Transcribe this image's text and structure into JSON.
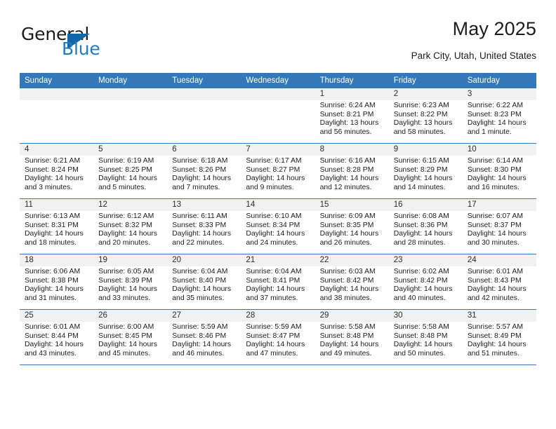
{
  "brand": {
    "name_part1": "General",
    "name_part2": "Blue",
    "logo_icon": "triangle-flag-icon"
  },
  "header": {
    "title": "May 2025",
    "subtitle": "Park City, Utah, United States"
  },
  "colors": {
    "header_blue": "#3378b8",
    "band_gray": "#f1f1f1",
    "logo_blue": "#1d7cc4",
    "logo_triangle": "#1566a8",
    "text": "#1c1c1c"
  },
  "calendar": {
    "weekday_headers": [
      "Sunday",
      "Monday",
      "Tuesday",
      "Wednesday",
      "Thursday",
      "Friday",
      "Saturday"
    ],
    "weeks": [
      [
        {
          "day": "",
          "sunrise": "",
          "sunset": "",
          "daylight1": "",
          "daylight2": "",
          "empty": true
        },
        {
          "day": "",
          "sunrise": "",
          "sunset": "",
          "daylight1": "",
          "daylight2": "",
          "empty": true
        },
        {
          "day": "",
          "sunrise": "",
          "sunset": "",
          "daylight1": "",
          "daylight2": "",
          "empty": true
        },
        {
          "day": "",
          "sunrise": "",
          "sunset": "",
          "daylight1": "",
          "daylight2": "",
          "empty": true
        },
        {
          "day": "1",
          "sunrise": "Sunrise: 6:24 AM",
          "sunset": "Sunset: 8:21 PM",
          "daylight1": "Daylight: 13 hours",
          "daylight2": "and 56 minutes."
        },
        {
          "day": "2",
          "sunrise": "Sunrise: 6:23 AM",
          "sunset": "Sunset: 8:22 PM",
          "daylight1": "Daylight: 13 hours",
          "daylight2": "and 58 minutes."
        },
        {
          "day": "3",
          "sunrise": "Sunrise: 6:22 AM",
          "sunset": "Sunset: 8:23 PM",
          "daylight1": "Daylight: 14 hours",
          "daylight2": "and 1 minute."
        }
      ],
      [
        {
          "day": "4",
          "sunrise": "Sunrise: 6:21 AM",
          "sunset": "Sunset: 8:24 PM",
          "daylight1": "Daylight: 14 hours",
          "daylight2": "and 3 minutes."
        },
        {
          "day": "5",
          "sunrise": "Sunrise: 6:19 AM",
          "sunset": "Sunset: 8:25 PM",
          "daylight1": "Daylight: 14 hours",
          "daylight2": "and 5 minutes."
        },
        {
          "day": "6",
          "sunrise": "Sunrise: 6:18 AM",
          "sunset": "Sunset: 8:26 PM",
          "daylight1": "Daylight: 14 hours",
          "daylight2": "and 7 minutes."
        },
        {
          "day": "7",
          "sunrise": "Sunrise: 6:17 AM",
          "sunset": "Sunset: 8:27 PM",
          "daylight1": "Daylight: 14 hours",
          "daylight2": "and 9 minutes."
        },
        {
          "day": "8",
          "sunrise": "Sunrise: 6:16 AM",
          "sunset": "Sunset: 8:28 PM",
          "daylight1": "Daylight: 14 hours",
          "daylight2": "and 12 minutes."
        },
        {
          "day": "9",
          "sunrise": "Sunrise: 6:15 AM",
          "sunset": "Sunset: 8:29 PM",
          "daylight1": "Daylight: 14 hours",
          "daylight2": "and 14 minutes."
        },
        {
          "day": "10",
          "sunrise": "Sunrise: 6:14 AM",
          "sunset": "Sunset: 8:30 PM",
          "daylight1": "Daylight: 14 hours",
          "daylight2": "and 16 minutes."
        }
      ],
      [
        {
          "day": "11",
          "sunrise": "Sunrise: 6:13 AM",
          "sunset": "Sunset: 8:31 PM",
          "daylight1": "Daylight: 14 hours",
          "daylight2": "and 18 minutes."
        },
        {
          "day": "12",
          "sunrise": "Sunrise: 6:12 AM",
          "sunset": "Sunset: 8:32 PM",
          "daylight1": "Daylight: 14 hours",
          "daylight2": "and 20 minutes."
        },
        {
          "day": "13",
          "sunrise": "Sunrise: 6:11 AM",
          "sunset": "Sunset: 8:33 PM",
          "daylight1": "Daylight: 14 hours",
          "daylight2": "and 22 minutes."
        },
        {
          "day": "14",
          "sunrise": "Sunrise: 6:10 AM",
          "sunset": "Sunset: 8:34 PM",
          "daylight1": "Daylight: 14 hours",
          "daylight2": "and 24 minutes."
        },
        {
          "day": "15",
          "sunrise": "Sunrise: 6:09 AM",
          "sunset": "Sunset: 8:35 PM",
          "daylight1": "Daylight: 14 hours",
          "daylight2": "and 26 minutes."
        },
        {
          "day": "16",
          "sunrise": "Sunrise: 6:08 AM",
          "sunset": "Sunset: 8:36 PM",
          "daylight1": "Daylight: 14 hours",
          "daylight2": "and 28 minutes."
        },
        {
          "day": "17",
          "sunrise": "Sunrise: 6:07 AM",
          "sunset": "Sunset: 8:37 PM",
          "daylight1": "Daylight: 14 hours",
          "daylight2": "and 30 minutes."
        }
      ],
      [
        {
          "day": "18",
          "sunrise": "Sunrise: 6:06 AM",
          "sunset": "Sunset: 8:38 PM",
          "daylight1": "Daylight: 14 hours",
          "daylight2": "and 31 minutes."
        },
        {
          "day": "19",
          "sunrise": "Sunrise: 6:05 AM",
          "sunset": "Sunset: 8:39 PM",
          "daylight1": "Daylight: 14 hours",
          "daylight2": "and 33 minutes."
        },
        {
          "day": "20",
          "sunrise": "Sunrise: 6:04 AM",
          "sunset": "Sunset: 8:40 PM",
          "daylight1": "Daylight: 14 hours",
          "daylight2": "and 35 minutes."
        },
        {
          "day": "21",
          "sunrise": "Sunrise: 6:04 AM",
          "sunset": "Sunset: 8:41 PM",
          "daylight1": "Daylight: 14 hours",
          "daylight2": "and 37 minutes."
        },
        {
          "day": "22",
          "sunrise": "Sunrise: 6:03 AM",
          "sunset": "Sunset: 8:42 PM",
          "daylight1": "Daylight: 14 hours",
          "daylight2": "and 38 minutes."
        },
        {
          "day": "23",
          "sunrise": "Sunrise: 6:02 AM",
          "sunset": "Sunset: 8:42 PM",
          "daylight1": "Daylight: 14 hours",
          "daylight2": "and 40 minutes."
        },
        {
          "day": "24",
          "sunrise": "Sunrise: 6:01 AM",
          "sunset": "Sunset: 8:43 PM",
          "daylight1": "Daylight: 14 hours",
          "daylight2": "and 42 minutes."
        }
      ],
      [
        {
          "day": "25",
          "sunrise": "Sunrise: 6:01 AM",
          "sunset": "Sunset: 8:44 PM",
          "daylight1": "Daylight: 14 hours",
          "daylight2": "and 43 minutes."
        },
        {
          "day": "26",
          "sunrise": "Sunrise: 6:00 AM",
          "sunset": "Sunset: 8:45 PM",
          "daylight1": "Daylight: 14 hours",
          "daylight2": "and 45 minutes."
        },
        {
          "day": "27",
          "sunrise": "Sunrise: 5:59 AM",
          "sunset": "Sunset: 8:46 PM",
          "daylight1": "Daylight: 14 hours",
          "daylight2": "and 46 minutes."
        },
        {
          "day": "28",
          "sunrise": "Sunrise: 5:59 AM",
          "sunset": "Sunset: 8:47 PM",
          "daylight1": "Daylight: 14 hours",
          "daylight2": "and 47 minutes."
        },
        {
          "day": "29",
          "sunrise": "Sunrise: 5:58 AM",
          "sunset": "Sunset: 8:48 PM",
          "daylight1": "Daylight: 14 hours",
          "daylight2": "and 49 minutes."
        },
        {
          "day": "30",
          "sunrise": "Sunrise: 5:58 AM",
          "sunset": "Sunset: 8:48 PM",
          "daylight1": "Daylight: 14 hours",
          "daylight2": "and 50 minutes."
        },
        {
          "day": "31",
          "sunrise": "Sunrise: 5:57 AM",
          "sunset": "Sunset: 8:49 PM",
          "daylight1": "Daylight: 14 hours",
          "daylight2": "and 51 minutes."
        }
      ]
    ]
  }
}
